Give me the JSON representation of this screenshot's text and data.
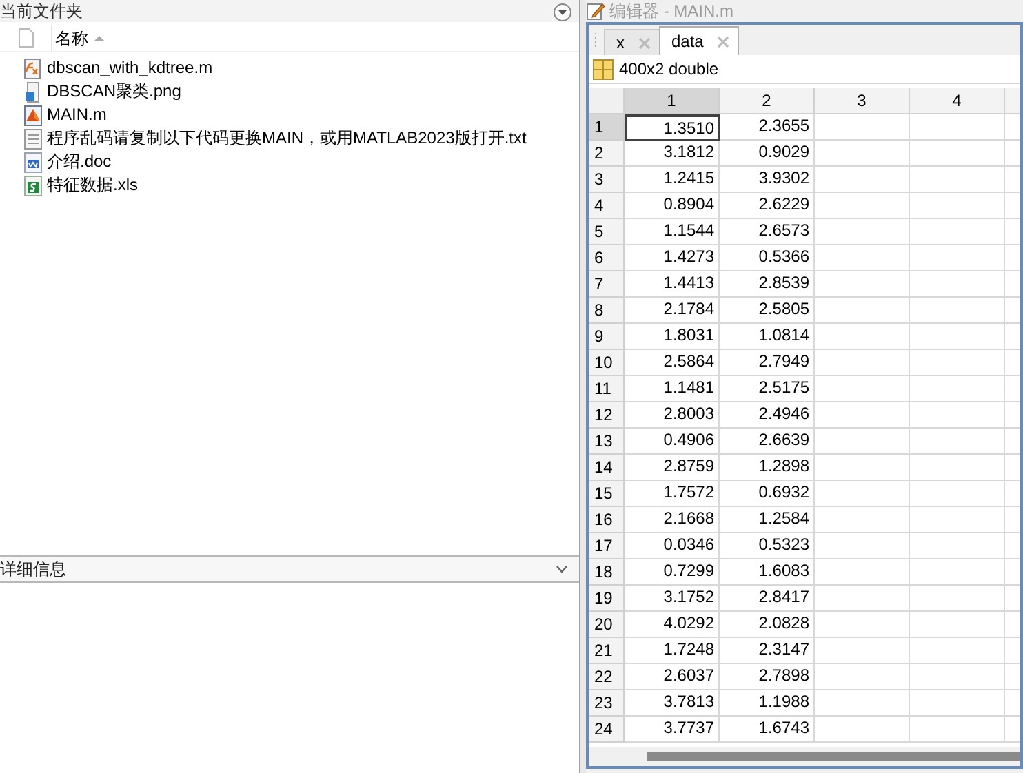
{
  "current_folder": {
    "title": "当前文件夹",
    "column_header": "名称",
    "files": [
      {
        "name": "dbscan_with_kdtree.m",
        "kind": "function"
      },
      {
        "name": "DBSCAN聚类.png",
        "kind": "image"
      },
      {
        "name": "MAIN.m",
        "kind": "script"
      },
      {
        "name": "程序乱码请复制以下代码更换MAIN，或用MATLAB2023版打开.txt",
        "kind": "text"
      },
      {
        "name": "介绍.doc",
        "kind": "word"
      },
      {
        "name": "特征数据.xls",
        "kind": "sheet"
      }
    ]
  },
  "details": {
    "title": "详细信息",
    "expanded": false
  },
  "editor": {
    "title": "编辑器 - MAIN.m",
    "tabs": [
      {
        "label": "x",
        "selected": false
      },
      {
        "label": "data",
        "selected": true
      }
    ],
    "variable_info": "400x2 double",
    "columns": [
      {
        "label": "1",
        "selected": true
      },
      {
        "label": "2",
        "selected": false
      },
      {
        "label": "3",
        "selected": false
      },
      {
        "label": "4",
        "selected": false
      }
    ],
    "rows": [
      {
        "label": "1",
        "cells": [
          "1.3510",
          "2.3655"
        ],
        "selected": true
      },
      {
        "label": "2",
        "cells": [
          "3.1812",
          "0.9029"
        ],
        "selected": false
      },
      {
        "label": "3",
        "cells": [
          "1.2415",
          "3.9302"
        ],
        "selected": false
      },
      {
        "label": "4",
        "cells": [
          "0.8904",
          "2.6229"
        ],
        "selected": false
      },
      {
        "label": "5",
        "cells": [
          "1.1544",
          "2.6573"
        ],
        "selected": false
      },
      {
        "label": "6",
        "cells": [
          "1.4273",
          "0.5366"
        ],
        "selected": false
      },
      {
        "label": "7",
        "cells": [
          "1.4413",
          "2.8539"
        ],
        "selected": false
      },
      {
        "label": "8",
        "cells": [
          "2.1784",
          "2.5805"
        ],
        "selected": false
      },
      {
        "label": "9",
        "cells": [
          "1.8031",
          "1.0814"
        ],
        "selected": false
      },
      {
        "label": "10",
        "cells": [
          "2.5864",
          "2.7949"
        ],
        "selected": false
      },
      {
        "label": "11",
        "cells": [
          "1.1481",
          "2.5175"
        ],
        "selected": false
      },
      {
        "label": "12",
        "cells": [
          "2.8003",
          "2.4946"
        ],
        "selected": false
      },
      {
        "label": "13",
        "cells": [
          "0.4906",
          "2.6639"
        ],
        "selected": false
      },
      {
        "label": "14",
        "cells": [
          "2.8759",
          "1.2898"
        ],
        "selected": false
      },
      {
        "label": "15",
        "cells": [
          "1.7572",
          "0.6932"
        ],
        "selected": false
      },
      {
        "label": "16",
        "cells": [
          "2.1668",
          "1.2584"
        ],
        "selected": false
      },
      {
        "label": "17",
        "cells": [
          "0.0346",
          "0.5323"
        ],
        "selected": false
      },
      {
        "label": "18",
        "cells": [
          "0.7299",
          "1.6083"
        ],
        "selected": false
      },
      {
        "label": "19",
        "cells": [
          "3.1752",
          "2.8417"
        ],
        "selected": false
      },
      {
        "label": "20",
        "cells": [
          "4.0292",
          "2.0828"
        ],
        "selected": false
      },
      {
        "label": "21",
        "cells": [
          "1.7248",
          "2.3147"
        ],
        "selected": false
      },
      {
        "label": "22",
        "cells": [
          "2.6037",
          "2.7898"
        ],
        "selected": false
      },
      {
        "label": "23",
        "cells": [
          "3.7813",
          "1.1988"
        ],
        "selected": false
      },
      {
        "label": "24",
        "cells": [
          "3.7737",
          "1.6743"
        ],
        "selected": false
      }
    ]
  }
}
